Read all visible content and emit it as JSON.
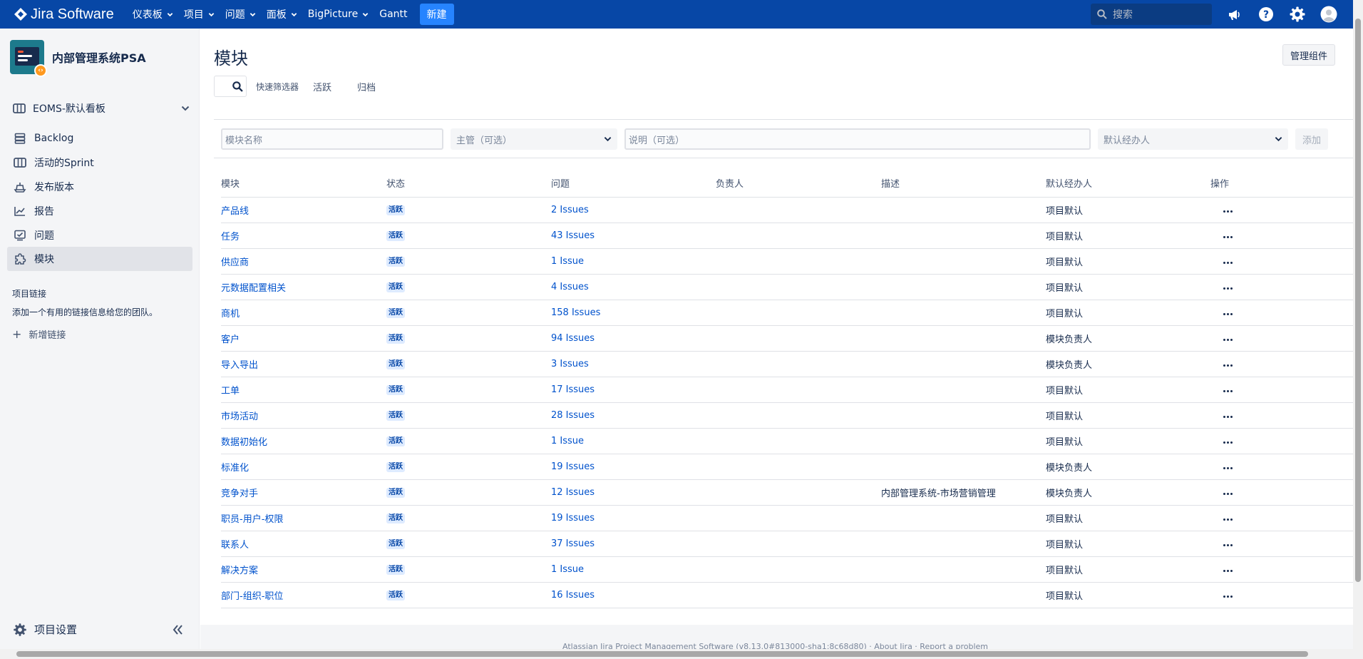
{
  "app": {
    "name": "Jira Software"
  },
  "topnav": {
    "items": [
      {
        "label": "仪表板"
      },
      {
        "label": "项目"
      },
      {
        "label": "问题"
      },
      {
        "label": "面板"
      },
      {
        "label": "BigPicture"
      },
      {
        "label": "Gantt"
      }
    ],
    "create_label": "新建",
    "search_placeholder": "搜索"
  },
  "sidebar": {
    "project_name": "内部管理系统PSA",
    "board_label": "EOMS-默认看板",
    "items": [
      {
        "label": "Backlog",
        "icon": "backlog-icon"
      },
      {
        "label": "活动的Sprint",
        "icon": "board-icon"
      },
      {
        "label": "发布版本",
        "icon": "ship-icon"
      },
      {
        "label": "报告",
        "icon": "chart-icon"
      },
      {
        "label": "问题",
        "icon": "issues-icon"
      },
      {
        "label": "模块",
        "icon": "component-icon",
        "active": true
      }
    ],
    "links_caption": "项目链接",
    "links_hint": "添加一个有用的链接信息给您的团队。",
    "add_link_label": "新增链接",
    "settings_label": "项目设置"
  },
  "main": {
    "title": "模块",
    "manage_button": "管理组件",
    "quick_filter_label": "快速筛选器",
    "tabs": [
      "活跃",
      "归档"
    ],
    "form": {
      "name_placeholder": "模块名称",
      "lead_placeholder": "主管（可选）",
      "desc_placeholder": "说明（可选）",
      "assignee_placeholder": "默认经办人",
      "add_label": "添加"
    },
    "table": {
      "headers": [
        "模块",
        "状态",
        "问题",
        "负责人",
        "描述",
        "默认经办人",
        "操作"
      ],
      "rows": [
        {
          "name": "产品线",
          "status": "活跃",
          "issues": "2 Issues",
          "lead": "",
          "desc": "",
          "assignee": "项目默认"
        },
        {
          "name": "任务",
          "status": "活跃",
          "issues": "43 Issues",
          "lead": "",
          "desc": "",
          "assignee": "项目默认"
        },
        {
          "name": "供应商",
          "status": "活跃",
          "issues": "1 Issue",
          "lead": "",
          "desc": "",
          "assignee": "项目默认"
        },
        {
          "name": "元数据配置相关",
          "status": "活跃",
          "issues": "4 Issues",
          "lead": "",
          "desc": "",
          "assignee": "项目默认"
        },
        {
          "name": "商机",
          "status": "活跃",
          "issues": "158 Issues",
          "lead": "",
          "desc": "",
          "assignee": "项目默认"
        },
        {
          "name": "客户",
          "status": "活跃",
          "issues": "94 Issues",
          "lead": "",
          "desc": "",
          "assignee": "模块负责人"
        },
        {
          "name": "导入导出",
          "status": "活跃",
          "issues": "3 Issues",
          "lead": "",
          "desc": "",
          "assignee": "模块负责人"
        },
        {
          "name": "工单",
          "status": "活跃",
          "issues": "17 Issues",
          "lead": "",
          "desc": "",
          "assignee": "项目默认"
        },
        {
          "name": "市场活动",
          "status": "活跃",
          "issues": "28 Issues",
          "lead": "",
          "desc": "",
          "assignee": "项目默认"
        },
        {
          "name": "数据初始化",
          "status": "活跃",
          "issues": "1 Issue",
          "lead": "",
          "desc": "",
          "assignee": "项目默认"
        },
        {
          "name": "标准化",
          "status": "活跃",
          "issues": "19 Issues",
          "lead": "",
          "desc": "",
          "assignee": "模块负责人"
        },
        {
          "name": "竞争对手",
          "status": "活跃",
          "issues": "12 Issues",
          "lead": "",
          "desc": "内部管理系统-市场营销管理",
          "assignee": "模块负责人"
        },
        {
          "name": "职员-用户-权限",
          "status": "活跃",
          "issues": "19 Issues",
          "lead": "",
          "desc": "",
          "assignee": "项目默认"
        },
        {
          "name": "联系人",
          "status": "活跃",
          "issues": "37 Issues",
          "lead": "",
          "desc": "",
          "assignee": "项目默认"
        },
        {
          "name": "解决方案",
          "status": "活跃",
          "issues": "1 Issue",
          "lead": "",
          "desc": "",
          "assignee": "项目默认"
        },
        {
          "name": "部门-组织-职位",
          "status": "活跃",
          "issues": "16 Issues",
          "lead": "",
          "desc": "",
          "assignee": "项目默认"
        }
      ]
    },
    "footer": "Atlassian Jira Project Management Software (v8.13.0#813000-sha1:8c68d80)  ·  About Jira  ·  Report a problem"
  },
  "colors": {
    "topbar": "#0747a6",
    "accent": "#2684ff",
    "link": "#0052cc",
    "lozenge_bg": "#deebff"
  }
}
